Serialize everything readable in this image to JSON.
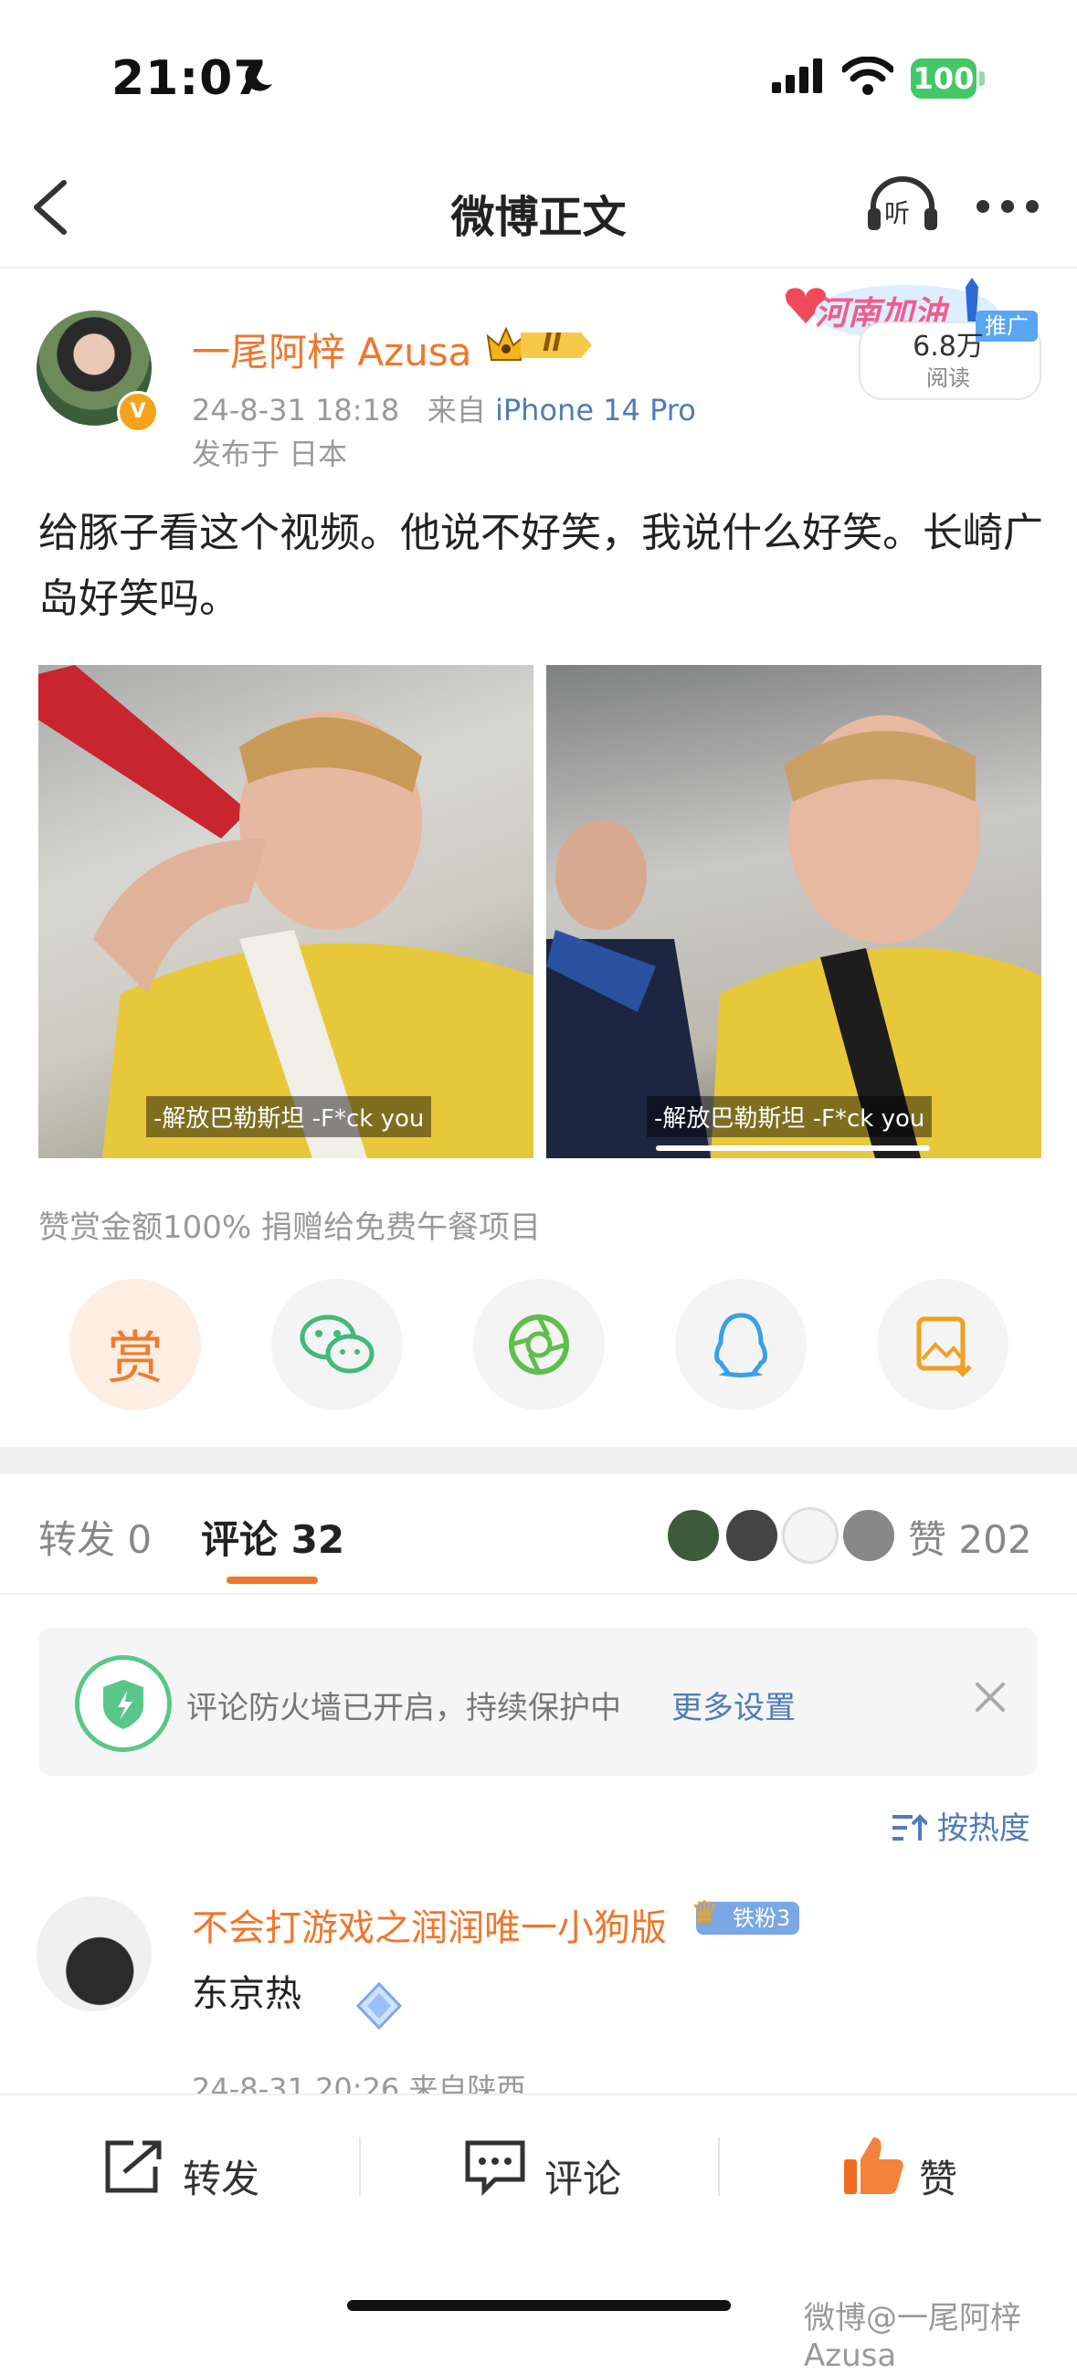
{
  "status_bar": {
    "time": "21:07",
    "battery": "100"
  },
  "nav": {
    "title": "微博正文",
    "listen_label": "听"
  },
  "promo": {
    "text": "河南加油",
    "badge": "推广",
    "reads_count": "6.8万",
    "reads_label": "阅读"
  },
  "post": {
    "author": "一尾阿梓 Azusa",
    "member_level": "II",
    "time": "24-8-31 18:18",
    "source_prefix": "来自",
    "device": "iPhone 14 Pro",
    "location": "发布于 日本",
    "text": "给豚子看这个视频。他说不好笑，我说什么好笑。长崎广岛好笑吗。",
    "media": [
      {
        "subtitle": "-解放巴勒斯坦 -F*ck you"
      },
      {
        "subtitle": "-解放巴勒斯坦 -F*ck you"
      }
    ],
    "donation_note": "赞赏金额100% 捐赠给免费午餐项目"
  },
  "share": {
    "reward_label": "赏"
  },
  "tabs": {
    "repost_label": "转发",
    "repost_count": "0",
    "comment_label": "评论",
    "comment_count": "32",
    "likes_label": "赞",
    "likes_count": "202"
  },
  "firewall": {
    "text": "评论防火墙已开启，持续保护中",
    "link": "更多设置"
  },
  "sort": {
    "label": "按热度"
  },
  "comment": {
    "name": "不会打游戏之润润唯一小狗版",
    "fan_badge": "铁粉3",
    "text": "东京热",
    "meta": "24-8-31 20:26  来自陕西"
  },
  "bottom_bar": {
    "repost": "转发",
    "comment": "评论",
    "like": "赞"
  },
  "watermark": "微博@一尾阿梓Azusa",
  "colors": {
    "accent": "#f0762b",
    "link": "#4f7cb7",
    "battery": "#44c767"
  }
}
